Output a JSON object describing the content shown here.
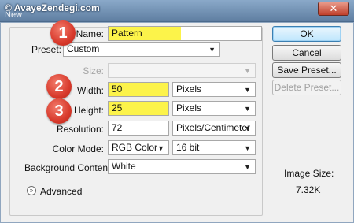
{
  "window": {
    "watermark": "© AvayeZendegi.com",
    "title": "New",
    "close_symbol": "✕"
  },
  "form": {
    "name_label": "Name:",
    "name_value": "Pattern",
    "preset_label": "Preset:",
    "preset_value": "Custom",
    "size_label": "Size:",
    "size_value": "",
    "width_label": "Width:",
    "width_value": "50",
    "width_unit": "Pixels",
    "height_label": "Height:",
    "height_value": "25",
    "height_unit": "Pixels",
    "resolution_label": "Resolution:",
    "resolution_value": "72",
    "resolution_unit": "Pixels/Centimeter",
    "color_mode_label": "Color Mode:",
    "color_mode_value": "RGB Color",
    "bit_depth": "16 bit",
    "background_label": "Background Contents:",
    "background_value": "White",
    "advanced_label": "Advanced"
  },
  "buttons": {
    "ok": "OK",
    "cancel": "Cancel",
    "save_preset": "Save Preset...",
    "delete_preset": "Delete Preset..."
  },
  "image_size": {
    "label": "Image Size:",
    "value": "7.32K"
  },
  "annotations": {
    "step1": "1",
    "step2": "2",
    "step3": "3"
  },
  "colors": {
    "highlight": "#fcf34a",
    "badge": "#d83a2c"
  }
}
